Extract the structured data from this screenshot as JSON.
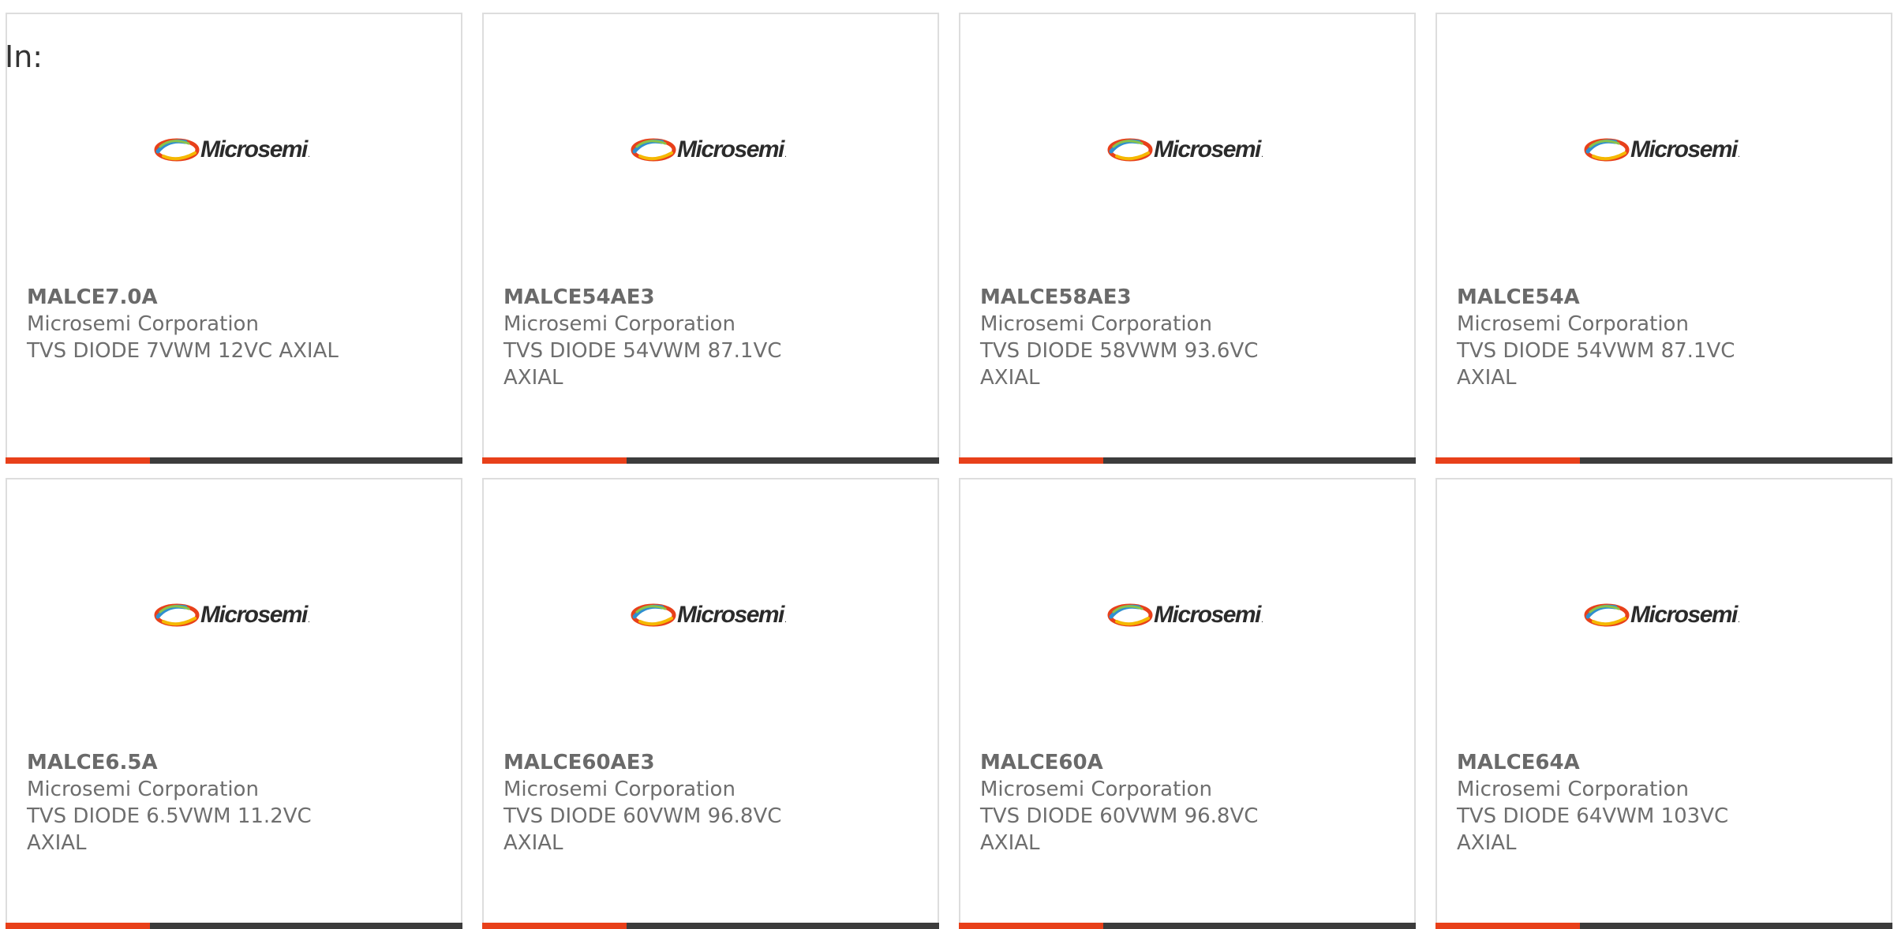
{
  "page": {
    "label": "In:"
  },
  "colors": {
    "accent": "#e8401a",
    "bar_dark": "#3c3c3c",
    "text": "#6e6e6e",
    "border": "#dddddd"
  },
  "logo": {
    "text": "Microsemi",
    "icon": "microsemi-swoosh-icon"
  },
  "products": [
    {
      "part": "MALCE7.0A",
      "manufacturer": "Microsemi Corporation",
      "description": "TVS DIODE 7VWM 12VC AXIAL"
    },
    {
      "part": "MALCE54AE3",
      "manufacturer": "Microsemi Corporation",
      "description": "TVS DIODE 54VWM 87.1VC AXIAL"
    },
    {
      "part": "MALCE58AE3",
      "manufacturer": "Microsemi Corporation",
      "description": "TVS DIODE 58VWM 93.6VC AXIAL"
    },
    {
      "part": "MALCE54A",
      "manufacturer": "Microsemi Corporation",
      "description": "TVS DIODE 54VWM 87.1VC AXIAL"
    },
    {
      "part": "MALCE6.5A",
      "manufacturer": "Microsemi Corporation",
      "description": "TVS DIODE 6.5VWM 11.2VC AXIAL"
    },
    {
      "part": "MALCE60AE3",
      "manufacturer": "Microsemi Corporation",
      "description": "TVS DIODE 60VWM 96.8VC AXIAL"
    },
    {
      "part": "MALCE60A",
      "manufacturer": "Microsemi Corporation",
      "description": "TVS DIODE 60VWM 96.8VC AXIAL"
    },
    {
      "part": "MALCE64A",
      "manufacturer": "Microsemi Corporation",
      "description": "TVS DIODE 64VWM 103VC AXIAL"
    }
  ]
}
